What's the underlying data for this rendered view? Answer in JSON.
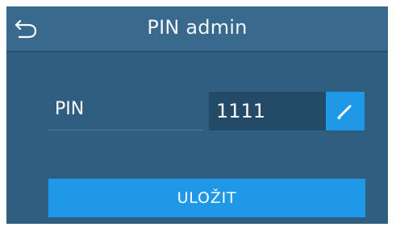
{
  "header": {
    "title": "PIN admin",
    "back_icon": "undo-arrow-icon"
  },
  "form": {
    "pin_label": "PIN",
    "pin_value": "1111",
    "edit_icon": "pencil-icon"
  },
  "actions": {
    "save_label": "ULOŽIT"
  },
  "colors": {
    "header_bg": "#39698c",
    "body_bg": "#2f5e80",
    "field_bg": "#234b68",
    "accent": "#1f98e8"
  }
}
